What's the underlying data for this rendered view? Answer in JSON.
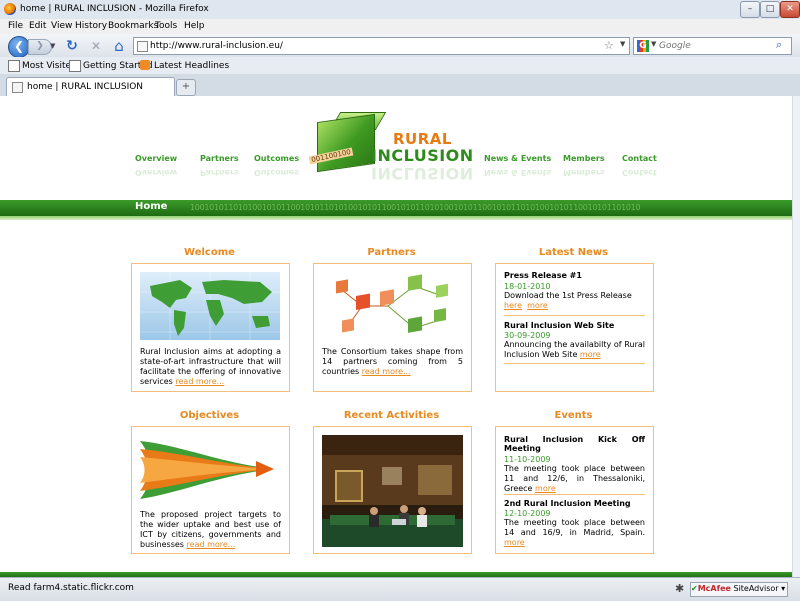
{
  "window": {
    "title": "home | RURAL INCLUSION - Mozilla Firefox",
    "min": "–",
    "max": "□",
    "close": "✕"
  },
  "menu": [
    "File",
    "Edit",
    "View",
    "History",
    "Bookmarks",
    "Tools",
    "Help"
  ],
  "toolbar": {
    "url": "http://www.rural-inclusion.eu/",
    "search_placeholder": "Google",
    "back_glyph": "❮",
    "fwd_glyph": "❯",
    "reload_glyph": "↻",
    "stop_glyph": "✕",
    "home_glyph": "⌂",
    "star_glyph": "☆",
    "search_glyph": "⌕"
  },
  "bookmarks": [
    "Most Visited",
    "Getting Started",
    "Latest Headlines"
  ],
  "tab": {
    "label": "home | RURAL INCLUSION",
    "new_glyph": "+"
  },
  "site": {
    "logo_line1": "RURAL",
    "logo_line2": "INCLUSION",
    "logo_bits": "001100100",
    "nav_left": [
      "Overview",
      "Partners",
      "Outcomes"
    ],
    "nav_right": [
      "News & Events",
      "Members",
      "Contact"
    ],
    "band_title": "Home",
    "band_binary": "1001010110101001010110010101101010010101100101011010100101011001010110101001010110010101101010"
  },
  "sections": {
    "welcome": {
      "title": "Welcome",
      "text": "Rural Inclusion aims at adopting a state-of-art infrastructure that will facilitate the offering of innovative services",
      "more": "read more..."
    },
    "partners": {
      "title": "Partners",
      "text": "The Consortium takes shape from 14 partners coming from 5 countries",
      "more": "read more..."
    },
    "news": {
      "title": "Latest News",
      "items": [
        {
          "title": "Press Release #1",
          "date": "18-01-2010",
          "text": "Download the 1st Press Release",
          "link1": "here",
          "link2": "more"
        },
        {
          "title": "Rural Inclusion Web Site",
          "date": "30-09-2009",
          "text": "Announcing the availabilty of Rural Inclusion Web Site",
          "link": "more"
        }
      ]
    },
    "objectives": {
      "title": "Objectives",
      "text": "The proposed project targets to the wider uptake and best use of ICT by citizens, governments and businesses",
      "more": "read more..."
    },
    "activities": {
      "title": "Recent Activities"
    },
    "events": {
      "title": "Events",
      "items": [
        {
          "title": "Rural Inclusion Kick Off Meeting",
          "date": "11-10-2009",
          "text": "The meeting took place between 11 and 12/6, in Thessaloniki, Greece",
          "link": "more"
        },
        {
          "title": "2nd Rural Inclusion Meeting",
          "date": "12-10-2009",
          "text": "The meeting took place between 14 and 16/9, in Madrid, Spain.",
          "link": "more"
        }
      ]
    }
  },
  "status": {
    "text": "Read farm4.static.flickr.com",
    "mcafee_brand": "McAfee",
    "mcafee_product": "SiteAdvisor"
  },
  "colors": {
    "green": "#3a9a2a",
    "orange": "#e78a22",
    "card_border": "#f4be7c"
  }
}
